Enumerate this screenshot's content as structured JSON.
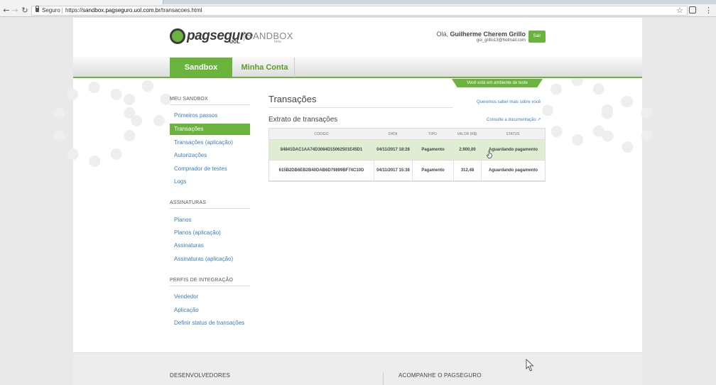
{
  "browser": {
    "secure_label": "Seguro",
    "url_prefix": "https://",
    "url_host": "sandbox.pagseguro.uol.com.br",
    "url_path": "/transacoes.html",
    "back_icon": "←",
    "forward_icon": "→",
    "reload_icon": "↻",
    "star_icon": "☆",
    "menu_icon": "⋮"
  },
  "header": {
    "logo_text": "pagseguro",
    "logo_sub": "UOL",
    "env_label": "SANDBOX",
    "beta_label": "beta",
    "greeting_prefix": "Olá, ",
    "user_name": "Guilherme Cherem Grillo",
    "user_email": "gui_grillo13@hotmail.com",
    "logout_label": "Sair"
  },
  "nav": {
    "tabs": [
      "Sandbox",
      "Minha Conta"
    ],
    "env_banner": "Você está em ambiente de teste"
  },
  "sidebar": {
    "sections": [
      {
        "title": "MEU SANDBOX",
        "items": [
          "Primeiros passos",
          "Transações",
          "Transações (aplicação)",
          "Autorizações",
          "Comprador de testes",
          "Logs"
        ],
        "active_index": 1
      },
      {
        "title": "ASSINATURAS",
        "items": [
          "Planos",
          "Planos (aplicação)",
          "Assinaturas",
          "Assinaturas (aplicação)"
        ]
      },
      {
        "title": "PERFIS DE INTEGRAÇÃO",
        "items": [
          "Vendedor",
          "Aplicação",
          "Definir status de transações"
        ]
      }
    ]
  },
  "main": {
    "title": "Transações",
    "feedback_link": "Queremos saber mais sobre você",
    "subtitle": "Extrato de transações",
    "doc_link": "Consulte a documentação",
    "table": {
      "columns": [
        "CÓDIGO",
        "DATA",
        "TIPO",
        "VALOR (R$)",
        "STATUS"
      ],
      "rows": [
        [
          "84841DAC1AA74D3084D15062501E45D1",
          "04/11/2017 18:28",
          "Pagamento",
          "2.900,00",
          "Aguardando pagamento"
        ],
        [
          "615B2DB6EB2B40DAB6D79899BF74C10D",
          "04/11/2017 15:38",
          "Pagamento",
          "312,48",
          "Aguardando pagamento"
        ]
      ],
      "highlighted_row": 0
    }
  },
  "footer": {
    "col1_title": "DESENVOLVEDORES",
    "col2_title": "ACOMPANHE O PAGSEGURO"
  },
  "colors": {
    "brand_green": "#6ab43e",
    "link_blue": "#3b7dc4",
    "highlight_row": "#dfeed3"
  }
}
